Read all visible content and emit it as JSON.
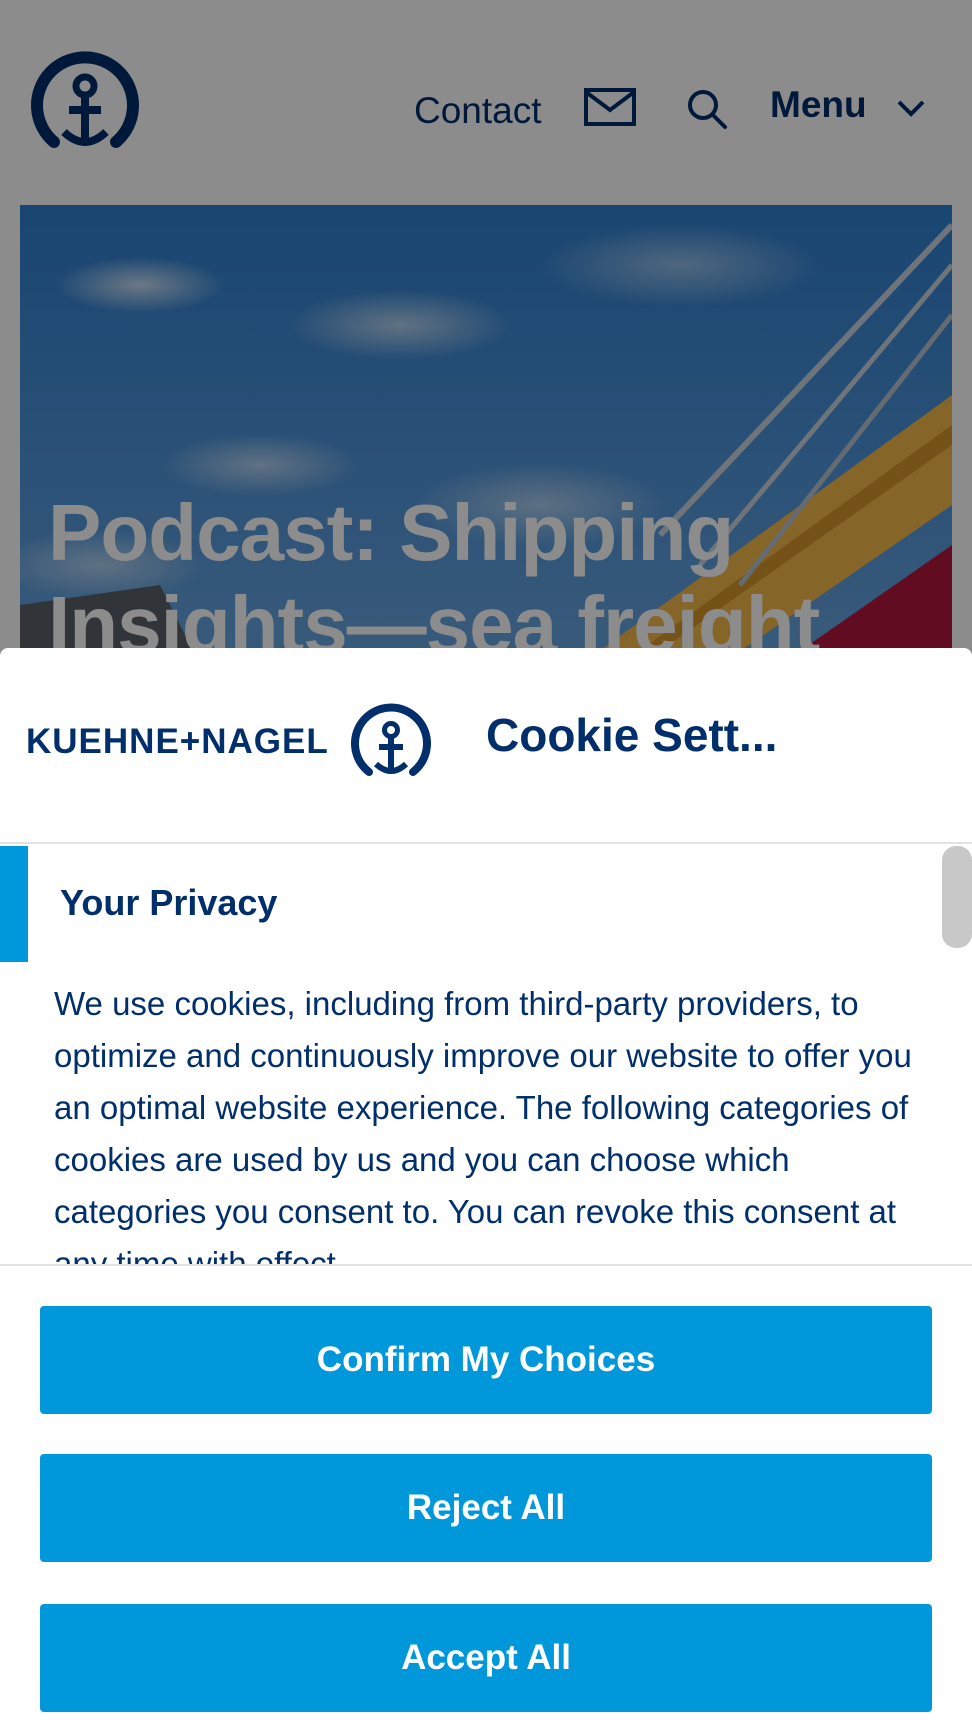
{
  "header": {
    "contact_label": "Contact",
    "menu_label": "Menu",
    "icons": [
      "anchor-logo-icon",
      "mail-icon",
      "search-icon",
      "chevron-down-icon"
    ]
  },
  "hero": {
    "title": "Podcast: Shipping Insights—sea freight"
  },
  "cookie_modal": {
    "brand": "KUEHNE+NAGEL",
    "title": "Cookie Sett...",
    "privacy_heading": "Your Privacy",
    "privacy_text": "We use cookies, including from third-party providers, to optimize and continuously improve our website to offer you an optimal website experience. The following categories of cookies are used by us and you can choose which categories you consent to. You can revoke this consent at any time with effect",
    "buttons": {
      "confirm": "Confirm My Choices",
      "reject": "Reject All",
      "accept": "Accept All"
    }
  },
  "colors": {
    "brand_navy": "#002f6c",
    "accent_blue": "#0097db",
    "overlay": "rgba(0,0,0,0.45)"
  }
}
